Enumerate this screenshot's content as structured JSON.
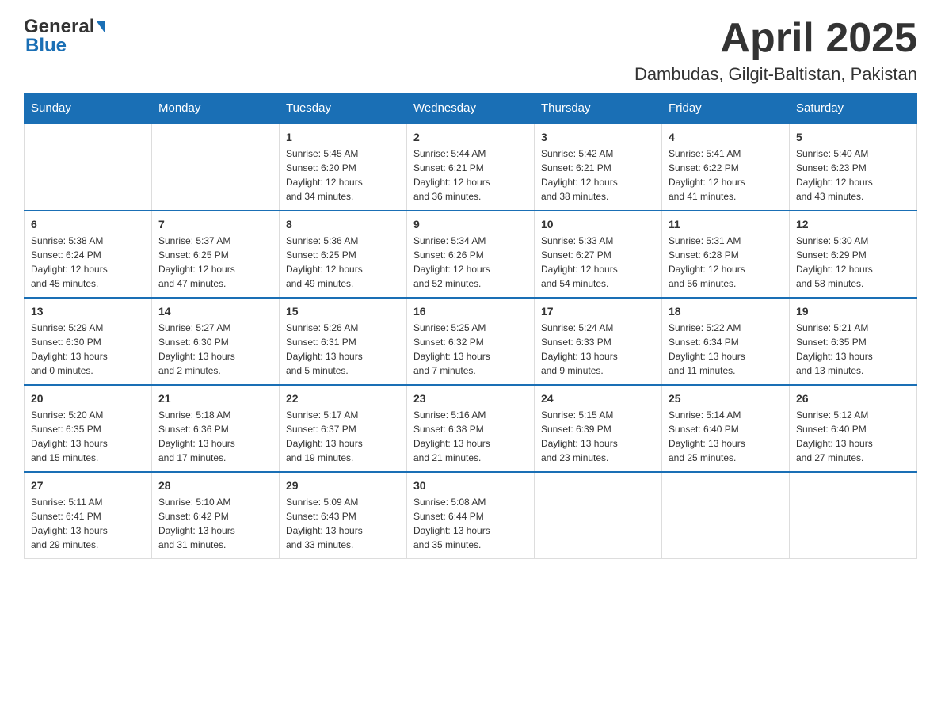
{
  "header": {
    "logo_general": "General",
    "logo_blue": "Blue",
    "month_title": "April 2025",
    "location": "Dambudas, Gilgit-Baltistan, Pakistan"
  },
  "weekdays": [
    "Sunday",
    "Monday",
    "Tuesday",
    "Wednesday",
    "Thursday",
    "Friday",
    "Saturday"
  ],
  "weeks": [
    [
      {
        "day": "",
        "info": ""
      },
      {
        "day": "",
        "info": ""
      },
      {
        "day": "1",
        "info": "Sunrise: 5:45 AM\nSunset: 6:20 PM\nDaylight: 12 hours\nand 34 minutes."
      },
      {
        "day": "2",
        "info": "Sunrise: 5:44 AM\nSunset: 6:21 PM\nDaylight: 12 hours\nand 36 minutes."
      },
      {
        "day": "3",
        "info": "Sunrise: 5:42 AM\nSunset: 6:21 PM\nDaylight: 12 hours\nand 38 minutes."
      },
      {
        "day": "4",
        "info": "Sunrise: 5:41 AM\nSunset: 6:22 PM\nDaylight: 12 hours\nand 41 minutes."
      },
      {
        "day": "5",
        "info": "Sunrise: 5:40 AM\nSunset: 6:23 PM\nDaylight: 12 hours\nand 43 minutes."
      }
    ],
    [
      {
        "day": "6",
        "info": "Sunrise: 5:38 AM\nSunset: 6:24 PM\nDaylight: 12 hours\nand 45 minutes."
      },
      {
        "day": "7",
        "info": "Sunrise: 5:37 AM\nSunset: 6:25 PM\nDaylight: 12 hours\nand 47 minutes."
      },
      {
        "day": "8",
        "info": "Sunrise: 5:36 AM\nSunset: 6:25 PM\nDaylight: 12 hours\nand 49 minutes."
      },
      {
        "day": "9",
        "info": "Sunrise: 5:34 AM\nSunset: 6:26 PM\nDaylight: 12 hours\nand 52 minutes."
      },
      {
        "day": "10",
        "info": "Sunrise: 5:33 AM\nSunset: 6:27 PM\nDaylight: 12 hours\nand 54 minutes."
      },
      {
        "day": "11",
        "info": "Sunrise: 5:31 AM\nSunset: 6:28 PM\nDaylight: 12 hours\nand 56 minutes."
      },
      {
        "day": "12",
        "info": "Sunrise: 5:30 AM\nSunset: 6:29 PM\nDaylight: 12 hours\nand 58 minutes."
      }
    ],
    [
      {
        "day": "13",
        "info": "Sunrise: 5:29 AM\nSunset: 6:30 PM\nDaylight: 13 hours\nand 0 minutes."
      },
      {
        "day": "14",
        "info": "Sunrise: 5:27 AM\nSunset: 6:30 PM\nDaylight: 13 hours\nand 2 minutes."
      },
      {
        "day": "15",
        "info": "Sunrise: 5:26 AM\nSunset: 6:31 PM\nDaylight: 13 hours\nand 5 minutes."
      },
      {
        "day": "16",
        "info": "Sunrise: 5:25 AM\nSunset: 6:32 PM\nDaylight: 13 hours\nand 7 minutes."
      },
      {
        "day": "17",
        "info": "Sunrise: 5:24 AM\nSunset: 6:33 PM\nDaylight: 13 hours\nand 9 minutes."
      },
      {
        "day": "18",
        "info": "Sunrise: 5:22 AM\nSunset: 6:34 PM\nDaylight: 13 hours\nand 11 minutes."
      },
      {
        "day": "19",
        "info": "Sunrise: 5:21 AM\nSunset: 6:35 PM\nDaylight: 13 hours\nand 13 minutes."
      }
    ],
    [
      {
        "day": "20",
        "info": "Sunrise: 5:20 AM\nSunset: 6:35 PM\nDaylight: 13 hours\nand 15 minutes."
      },
      {
        "day": "21",
        "info": "Sunrise: 5:18 AM\nSunset: 6:36 PM\nDaylight: 13 hours\nand 17 minutes."
      },
      {
        "day": "22",
        "info": "Sunrise: 5:17 AM\nSunset: 6:37 PM\nDaylight: 13 hours\nand 19 minutes."
      },
      {
        "day": "23",
        "info": "Sunrise: 5:16 AM\nSunset: 6:38 PM\nDaylight: 13 hours\nand 21 minutes."
      },
      {
        "day": "24",
        "info": "Sunrise: 5:15 AM\nSunset: 6:39 PM\nDaylight: 13 hours\nand 23 minutes."
      },
      {
        "day": "25",
        "info": "Sunrise: 5:14 AM\nSunset: 6:40 PM\nDaylight: 13 hours\nand 25 minutes."
      },
      {
        "day": "26",
        "info": "Sunrise: 5:12 AM\nSunset: 6:40 PM\nDaylight: 13 hours\nand 27 minutes."
      }
    ],
    [
      {
        "day": "27",
        "info": "Sunrise: 5:11 AM\nSunset: 6:41 PM\nDaylight: 13 hours\nand 29 minutes."
      },
      {
        "day": "28",
        "info": "Sunrise: 5:10 AM\nSunset: 6:42 PM\nDaylight: 13 hours\nand 31 minutes."
      },
      {
        "day": "29",
        "info": "Sunrise: 5:09 AM\nSunset: 6:43 PM\nDaylight: 13 hours\nand 33 minutes."
      },
      {
        "day": "30",
        "info": "Sunrise: 5:08 AM\nSunset: 6:44 PM\nDaylight: 13 hours\nand 35 minutes."
      },
      {
        "day": "",
        "info": ""
      },
      {
        "day": "",
        "info": ""
      },
      {
        "day": "",
        "info": ""
      }
    ]
  ]
}
